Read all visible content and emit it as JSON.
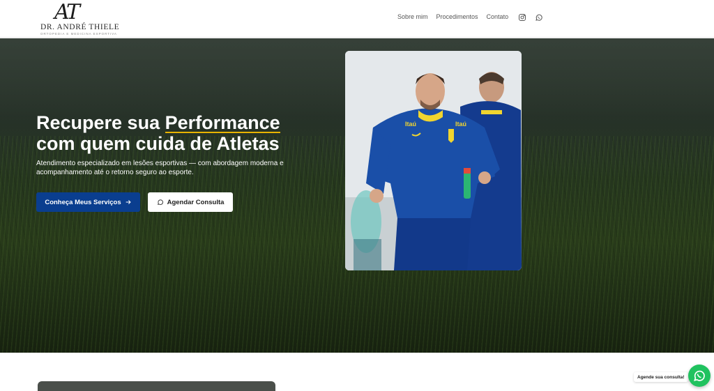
{
  "header": {
    "logo": {
      "monogram": "AT",
      "name": "DR. ANDRÉ THIELE",
      "tagline": "Ortopedia e Medicina Esportiva"
    },
    "nav": [
      {
        "label": "Sobre mim"
      },
      {
        "label": "Procedimentos"
      },
      {
        "label": "Contato"
      }
    ],
    "social": [
      {
        "icon": "instagram-icon"
      },
      {
        "icon": "whatsapp-icon"
      }
    ]
  },
  "hero": {
    "title_prefix": "Recupere sua ",
    "title_highlight": "Performance",
    "title_line2": "com quem cuida de Atletas",
    "description": "Atendimento especializado em lesões esportivas — com abordagem moderna e acompanhamento até o retorno seguro ao esporte.",
    "primary_button": "Conheça Meus Serviços",
    "secondary_button": "Agendar Consulta",
    "highlight_color": "#e8b400",
    "primary_color": "#0a3e8f"
  },
  "photo": {
    "jersey_text": "Itaú"
  },
  "whatsapp_float": {
    "label": "Agende sua consulta!",
    "color": "#20c25f"
  }
}
